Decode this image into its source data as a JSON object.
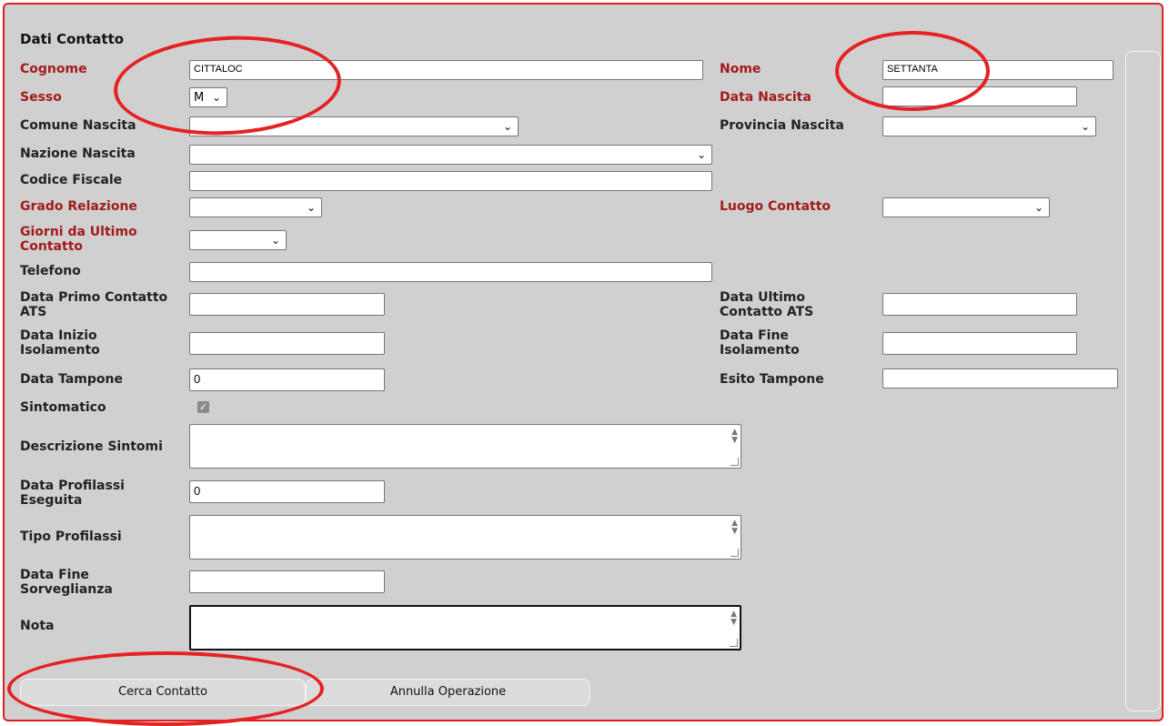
{
  "section_title": "Dati Contatto",
  "labels": {
    "cognome": "Cognome",
    "nome": "Nome",
    "sesso": "Sesso",
    "data_nascita": "Data Nascita",
    "comune_nascita": "Comune Nascita",
    "provincia_nascita": "Provincia Nascita",
    "nazione_nascita": "Nazione Nascita",
    "codice_fiscale": "Codice Fiscale",
    "grado_relazione": "Grado Relazione",
    "luogo_contatto": "Luogo Contatto",
    "giorni_ultimo_1": "Giorni da Ultimo",
    "giorni_ultimo_2": "Contatto",
    "telefono": "Telefono",
    "data_primo_1": "Data Primo Contatto",
    "data_primo_2": "ATS",
    "data_ultimo_1": "Data Ultimo",
    "data_ultimo_2": "Contatto ATS",
    "data_inizio_1": "Data Inizio",
    "data_inizio_2": "Isolamento",
    "data_fine_iso_1": "Data Fine",
    "data_fine_iso_2": "Isolamento",
    "data_tampone": "Data Tampone",
    "esito_tampone": "Esito Tampone",
    "sintomatico": "Sintomatico",
    "descrizione_sintomi": "Descrizione Sintomi",
    "data_profilassi_1": "Data Profilassi",
    "data_profilassi_2": "Eseguita",
    "tipo_profilassi": "Tipo Profilassi",
    "data_fine_sorv_1": "Data Fine",
    "data_fine_sorv_2": "Sorveglianza",
    "nota": "Nota"
  },
  "values": {
    "cognome": "CITTALOC",
    "nome": "SETTANTA",
    "sesso": "M",
    "data_tampone": "0",
    "data_profilassi": "0",
    "sintomatico_checked": true
  },
  "buttons": {
    "cerca": "Cerca Contatto",
    "annulla": "Annulla Operazione"
  },
  "icons": {
    "edit": "pencil-arrow-icon",
    "checkbox": "checkmark-icon",
    "dropdown": "chevron-down-icon"
  },
  "colors": {
    "required_label": "#a41a1a",
    "annotation": "#e52222",
    "panel_bg": "#d0d0d0"
  }
}
